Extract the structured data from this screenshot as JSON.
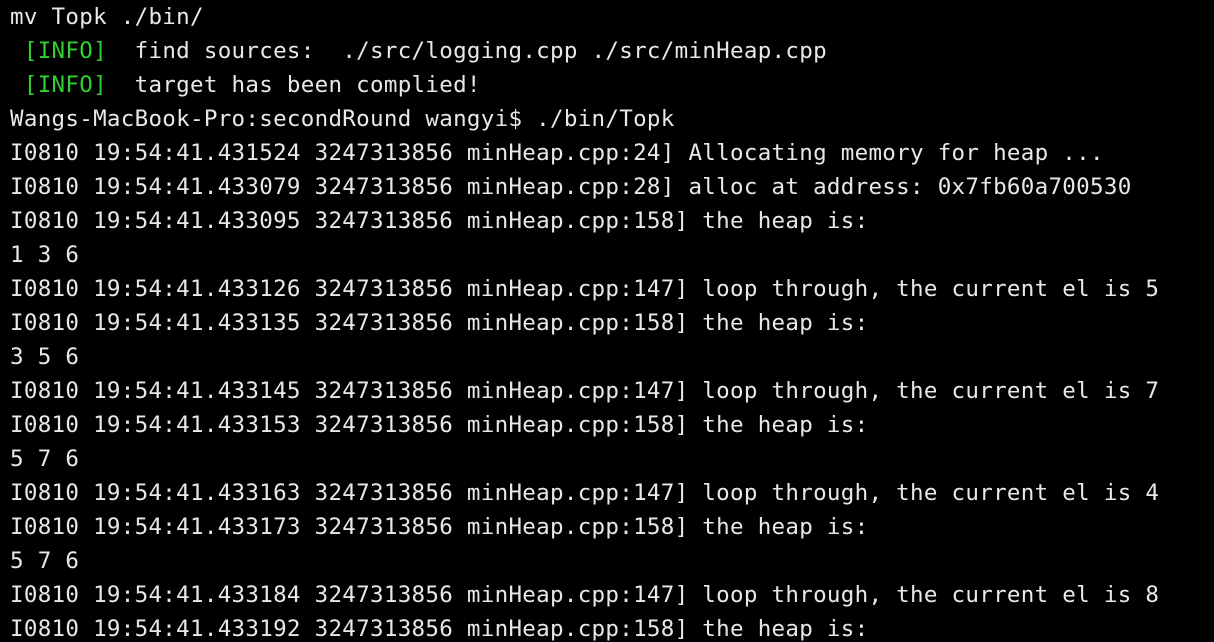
{
  "terminal": {
    "colors": {
      "background": "#000000",
      "text": "#e8e8e8",
      "info_tag": "#2fd12f"
    },
    "lines": [
      {
        "kind": "plain",
        "text": "mv Topk ./bin/"
      },
      {
        "kind": "info",
        "prefix": " ",
        "tag": "[INFO]",
        "message": "  find sources:  ./src/logging.cpp ./src/minHeap.cpp"
      },
      {
        "kind": "info",
        "prefix": " ",
        "tag": "[INFO]",
        "message": "  target has been complied!"
      },
      {
        "kind": "plain",
        "text": "Wangs-MacBook-Pro:secondRound wangyi$ ./bin/Topk"
      },
      {
        "kind": "plain",
        "text": "I0810 19:54:41.431524 3247313856 minHeap.cpp:24] Allocating memory for heap ..."
      },
      {
        "kind": "plain",
        "text": "I0810 19:54:41.433079 3247313856 minHeap.cpp:28] alloc at address: 0x7fb60a700530"
      },
      {
        "kind": "plain",
        "text": "I0810 19:54:41.433095 3247313856 minHeap.cpp:158] the heap is:"
      },
      {
        "kind": "plain",
        "text": "1 3 6"
      },
      {
        "kind": "plain",
        "text": "I0810 19:54:41.433126 3247313856 minHeap.cpp:147] loop through, the current el is 5"
      },
      {
        "kind": "plain",
        "text": "I0810 19:54:41.433135 3247313856 minHeap.cpp:158] the heap is:"
      },
      {
        "kind": "plain",
        "text": "3 5 6"
      },
      {
        "kind": "plain",
        "text": "I0810 19:54:41.433145 3247313856 minHeap.cpp:147] loop through, the current el is 7"
      },
      {
        "kind": "plain",
        "text": "I0810 19:54:41.433153 3247313856 minHeap.cpp:158] the heap is:"
      },
      {
        "kind": "plain",
        "text": "5 7 6"
      },
      {
        "kind": "plain",
        "text": "I0810 19:54:41.433163 3247313856 minHeap.cpp:147] loop through, the current el is 4"
      },
      {
        "kind": "plain",
        "text": "I0810 19:54:41.433173 3247313856 minHeap.cpp:158] the heap is:"
      },
      {
        "kind": "plain",
        "text": "5 7 6"
      },
      {
        "kind": "plain",
        "text": "I0810 19:54:41.433184 3247313856 minHeap.cpp:147] loop through, the current el is 8"
      },
      {
        "kind": "plain",
        "text": "I0810 19:54:41.433192 3247313856 minHeap.cpp:158] the heap is:"
      }
    ]
  }
}
